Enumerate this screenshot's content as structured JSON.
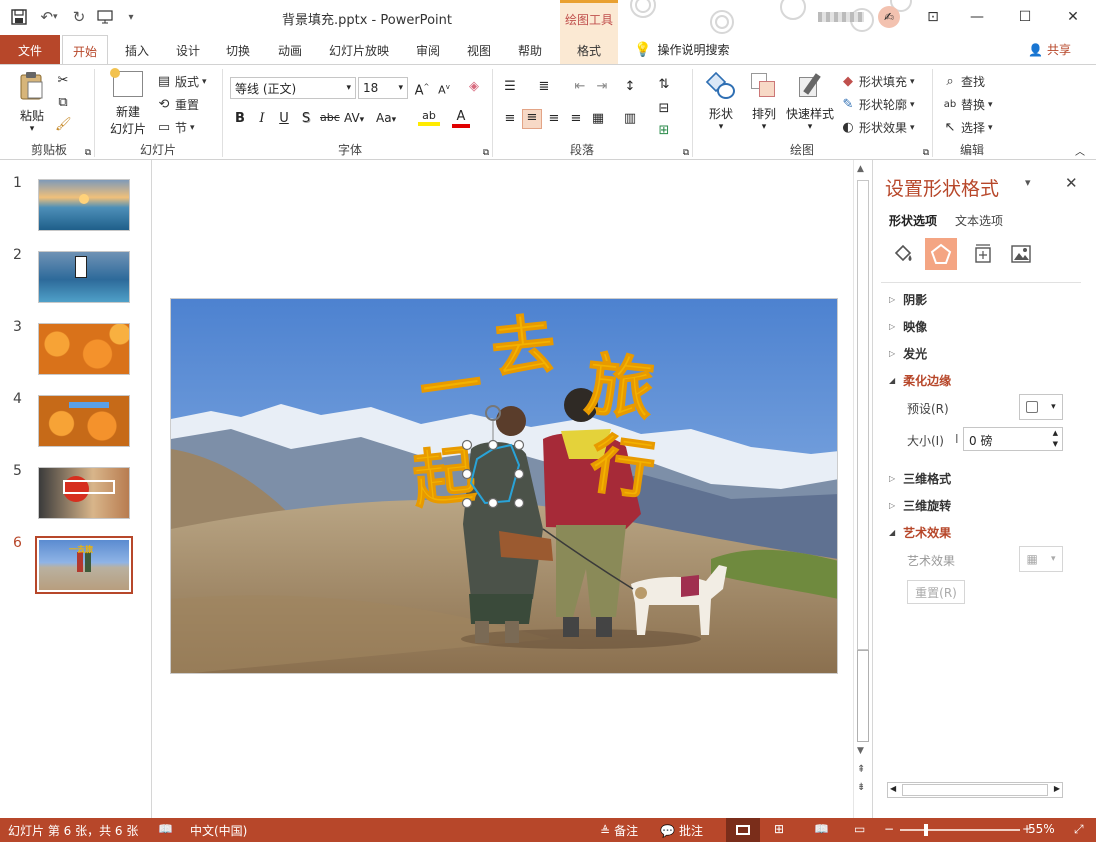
{
  "window": {
    "title": "背景填充.pptx  -  PowerPoint",
    "context_tools": "绘图工具",
    "share": "共享",
    "colors": {
      "accent": "#b7472a",
      "context": "#fbe9d3",
      "text": "#262626"
    }
  },
  "tabs": [
    "文件",
    "开始",
    "插入",
    "设计",
    "切换",
    "动画",
    "幻灯片放映",
    "审阅",
    "视图",
    "帮助",
    "格式"
  ],
  "tell_me": "操作说明搜索",
  "ribbon": {
    "clipboard": {
      "paste": "粘贴",
      "label": "剪贴板"
    },
    "slides": {
      "new_slide_1": "新建",
      "new_slide_2": "幻灯片",
      "layout": "版式",
      "reset": "重置",
      "section": "节",
      "label": "幻灯片"
    },
    "font": {
      "name": "等线 (正文)",
      "size": "18",
      "bold": "B",
      "italic": "I",
      "underline": "U",
      "shadow": "S",
      "strike": "abc",
      "spacing": "AV",
      "case": "Aa",
      "label": "字体"
    },
    "paragraph": {
      "label": "段落"
    },
    "drawing": {
      "shapes": "形状",
      "arrange": "排列",
      "quick_styles": "快速样式",
      "fill": "形状填充",
      "outline": "形状轮廓",
      "effects": "形状效果",
      "label": "绘图"
    },
    "editing": {
      "find": "查找",
      "replace": "替换",
      "select": "选择",
      "label": "编辑"
    }
  },
  "slides": [
    {
      "number": "1"
    },
    {
      "number": "2"
    },
    {
      "number": "3"
    },
    {
      "number": "4"
    },
    {
      "number": "5"
    },
    {
      "number": "6",
      "selected": true
    }
  ],
  "slide_text": [
    "一",
    "去",
    "旅",
    "起",
    "行"
  ],
  "pane": {
    "title": "设置形状格式",
    "tab_shape": "形状选项",
    "tab_text": "文本选项",
    "sections": [
      {
        "label": "阴影",
        "open": false
      },
      {
        "label": "映像",
        "open": false
      },
      {
        "label": "发光",
        "open": false
      },
      {
        "label": "柔化边缘",
        "open": true
      },
      {
        "label": "三维格式",
        "open": false
      },
      {
        "label": "三维旋转",
        "open": false
      },
      {
        "label": "艺术效果",
        "open": true
      }
    ],
    "preset_label": "预设(R)",
    "size_label": "大小(I)",
    "size_value": "0 磅",
    "art_effect_label": "艺术效果",
    "reset_label": "重置(R)"
  },
  "status": {
    "slide_info": "幻灯片 第 6 张，共 6 张",
    "language": "中文(中国)",
    "notes": "备注",
    "comments": "批注",
    "zoom": "55%"
  }
}
